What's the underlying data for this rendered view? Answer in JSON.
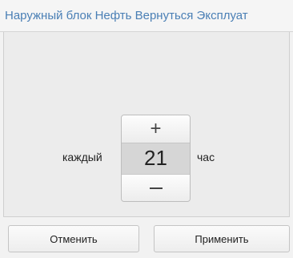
{
  "header": {
    "title": "Наружный блок Нефть Вернуться Эксплуат"
  },
  "schedule": {
    "every_label": "каждый",
    "value": "21",
    "unit_label": "час",
    "increment_symbol": "+"
  },
  "footer": {
    "cancel_label": "Отменить",
    "apply_label": "Применить"
  }
}
